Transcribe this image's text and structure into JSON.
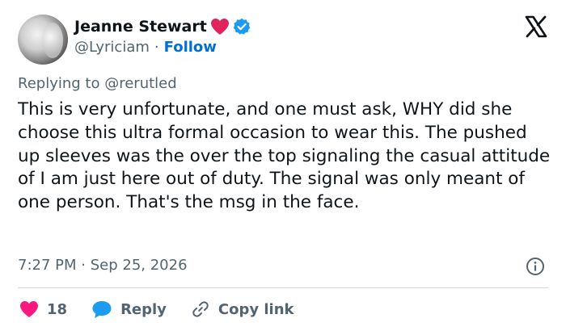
{
  "author": {
    "name": "Jeanne Stewart",
    "handle": "@Lyriciam",
    "separator": "·",
    "follow_label": "Follow"
  },
  "reply_context": {
    "prefix": "Replying to",
    "target": "@rerutled"
  },
  "tweet": {
    "text": "This is very unfortunate, and one must ask,  WHY did she choose this ultra formal occasion to wear this. The pushed up sleeves was the over the top signaling the casual attitude of I am just here out of duty. The signal was only meant of one person. That's the msg in the face.",
    "time": "7:27 PM",
    "separator": "·",
    "date": "Sep 25, 2026"
  },
  "actions": {
    "like_count": "18",
    "reply_label": "Reply",
    "copy_link_label": "Copy link"
  },
  "icons": {
    "heart": "heart-icon",
    "verified": "verified-badge-icon",
    "x_logo": "x-logo-icon",
    "info": "info-icon",
    "like": "like-heart-icon",
    "reply": "reply-bubble-icon",
    "link": "link-icon"
  },
  "colors": {
    "heart_red": "#e0245e",
    "verified_blue": "#1d9bf0",
    "follow_blue": "#006fd6",
    "like_pink": "#f91880",
    "reply_blue": "#1d9bf0",
    "muted_text": "#536471"
  }
}
